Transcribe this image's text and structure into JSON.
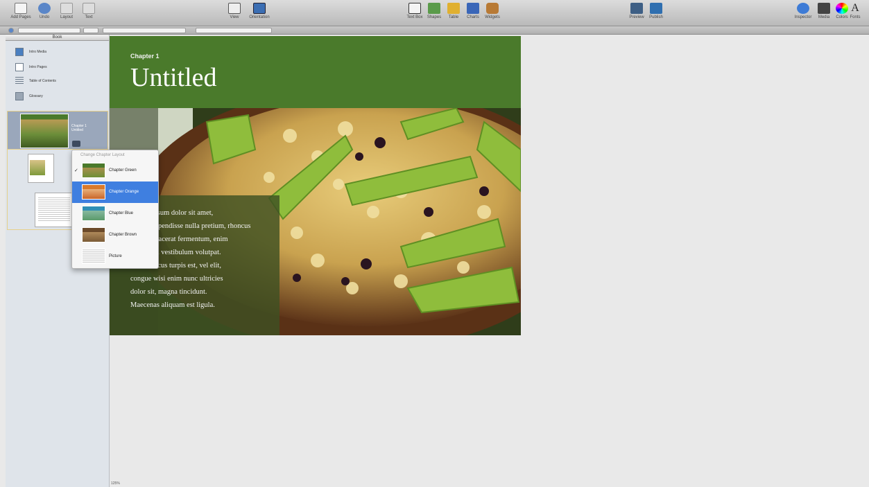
{
  "toolbar": {
    "left_buttons": [
      {
        "label": "Add Pages",
        "icon": "add-page-icon"
      },
      {
        "label": "Undo",
        "icon": "undo-icon"
      },
      {
        "label": "Layout",
        "icon": "layout-icon"
      },
      {
        "label": "Text",
        "icon": "text-view-icon"
      }
    ],
    "view_buttons": [
      {
        "label": "View",
        "icon": "view-icon"
      },
      {
        "label": "Orientation",
        "icon": "orientation-icon"
      }
    ],
    "insert_buttons": [
      {
        "label": "Text Box",
        "icon": "textbox-icon"
      },
      {
        "label": "Shapes",
        "icon": "shapes-icon"
      },
      {
        "label": "Table",
        "icon": "table-icon"
      },
      {
        "label": "Charts",
        "icon": "charts-icon"
      },
      {
        "label": "Widgets",
        "icon": "widgets-icon"
      }
    ],
    "publish_buttons": [
      {
        "label": "Preview",
        "icon": "preview-icon"
      },
      {
        "label": "Publish",
        "icon": "publish-icon"
      }
    ],
    "right_buttons": [
      {
        "label": "Inspector",
        "icon": "inspector-icon"
      },
      {
        "label": "Media",
        "icon": "media-icon"
      },
      {
        "label": "Colors",
        "icon": "colors-icon"
      },
      {
        "label": "Fonts",
        "icon": "fonts-icon"
      }
    ]
  },
  "sidebar": {
    "header": "Book",
    "items": [
      {
        "label": "Intro Media",
        "icon": "intro-media-icon"
      },
      {
        "label": "Intro Pages",
        "icon": "intro-pages-icon"
      },
      {
        "label": "Table of Contents",
        "icon": "toc-icon"
      },
      {
        "label": "Glossary",
        "icon": "glossary-icon"
      }
    ],
    "chapter_thumb_title": "Chapter 1 Untitled"
  },
  "layout_menu": {
    "header": "Change Chapter Layout",
    "items": [
      {
        "label": "Chapter Green",
        "checked": true,
        "selected": false,
        "color": "#4a7a2b"
      },
      {
        "label": "Chapter Orange",
        "checked": false,
        "selected": true,
        "color": "#d97a2b"
      },
      {
        "label": "Chapter Blue",
        "checked": false,
        "selected": false,
        "color": "#2f8fb5"
      },
      {
        "label": "Chapter Brown",
        "checked": false,
        "selected": false,
        "color": "#6b4a2a"
      },
      {
        "label": "Picture",
        "checked": false,
        "selected": false,
        "color": "#e8e8e8"
      }
    ]
  },
  "page": {
    "chapter_label": "Chapter 1",
    "title": "Untitled",
    "body_lines": [
      "Lorem ipsum dolor sit amet,",
      "ligula suspendisse nulla pretium, rhoncus",
      "tempor placerat fermentum, enim",
      "integer ad vestibulum volutpat.",
      "Nisl rhoncus turpis est, vel elit,",
      "congue wisi enim nunc ultricies",
      "dolor sit, magna tincidunt.",
      "Maecenas aliquam est ligula."
    ],
    "banner_color": "#4a7a2b"
  },
  "footer": {
    "zoom": "125%"
  }
}
